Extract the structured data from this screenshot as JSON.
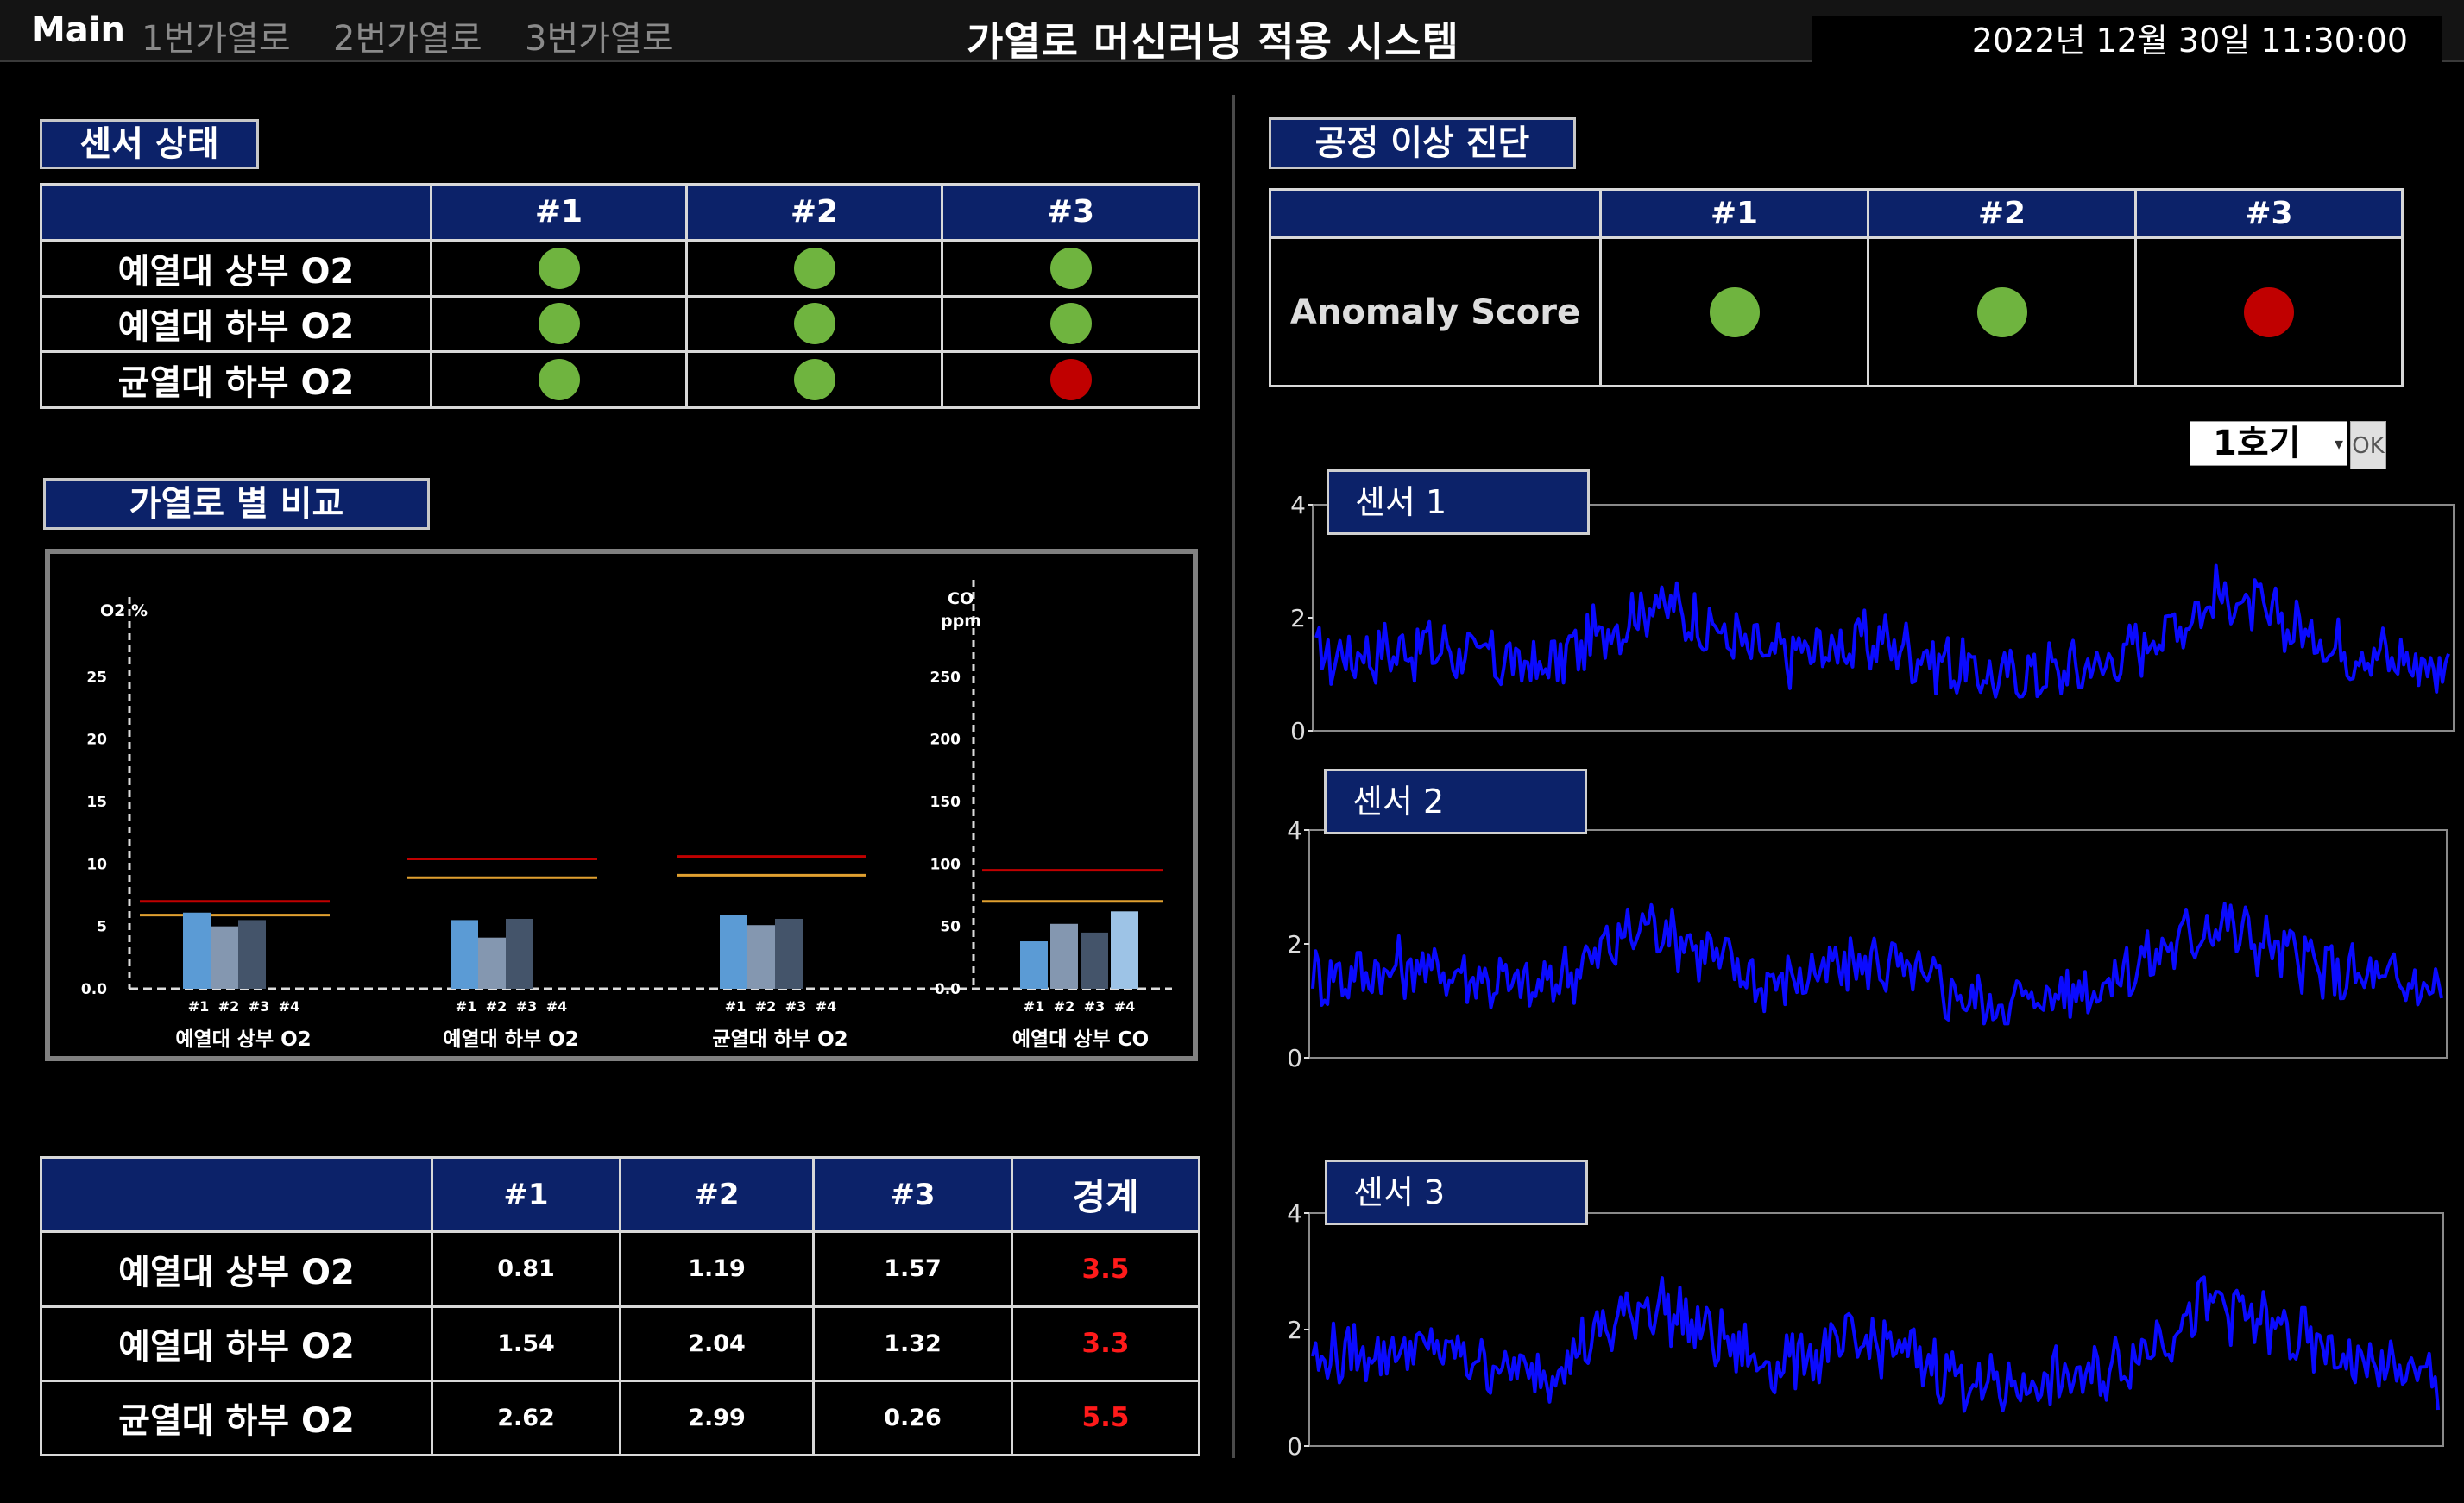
{
  "nav": {
    "main": "Main",
    "items": [
      "1번가열로",
      "2번가열로",
      "3번가열로"
    ],
    "title": "가열로 머신러닝 적용 시스템",
    "datetime": "2022년 12월 30일 11:30:00"
  },
  "sensor_status": {
    "badge": "센서 상태",
    "columns": [
      "#1",
      "#2",
      "#3"
    ],
    "rows": [
      {
        "label": "예열대 상부 O2",
        "status": [
          "green",
          "green",
          "green"
        ]
      },
      {
        "label": "예열대 하부 O2",
        "status": [
          "green",
          "green",
          "green"
        ]
      },
      {
        "label": "균열대 하부 O2",
        "status": [
          "green",
          "green",
          "red"
        ]
      }
    ]
  },
  "process_diag": {
    "badge": "공정 이상 진단",
    "columns": [
      "#1",
      "#2",
      "#3"
    ],
    "row_label": "Anomaly Score",
    "status": [
      "green",
      "green",
      "red"
    ]
  },
  "compare": {
    "badge": "가열로 별 비교",
    "left_axis_label": "O2 %",
    "right_axis_label_1": "CO",
    "right_axis_label_2": "ppm"
  },
  "chart_data": [
    {
      "type": "bar",
      "title": "",
      "ylabel": "O2 %",
      "ylim": [
        0,
        30
      ],
      "yticks": [
        "0.0",
        "5",
        "10",
        "15",
        "20",
        "25"
      ],
      "groups": [
        {
          "label": "예열대 상부 O2",
          "categories": [
            "#1",
            "#2",
            "#3",
            "#4"
          ],
          "values": [
            6.1,
            5.0,
            5.5,
            null
          ],
          "limit_red": 7.0,
          "limit_orange": 5.9
        },
        {
          "label": "예열대 하부 O2",
          "categories": [
            "#1",
            "#2",
            "#3",
            "#4"
          ],
          "values": [
            5.5,
            4.1,
            5.6,
            null
          ],
          "limit_red": 10.4,
          "limit_orange": 8.9
        },
        {
          "label": "균열대 하부 O2",
          "categories": [
            "#1",
            "#2",
            "#3",
            "#4"
          ],
          "values": [
            5.9,
            5.1,
            5.6,
            null
          ],
          "limit_red": 10.6,
          "limit_orange": 9.1
        }
      ],
      "bar_colors": [
        "#5b9bd5",
        "#8497b0",
        "#44546a"
      ],
      "red_line_color": "#c00000",
      "orange_line_color": "#e0a030"
    },
    {
      "type": "bar",
      "title": "",
      "ylabel": "CO ppm",
      "ylim": [
        0,
        300
      ],
      "yticks": [
        "0.0",
        "50",
        "100",
        "150",
        "200",
        "250"
      ],
      "groups": [
        {
          "label": "예열대 상부 CO",
          "categories": [
            "#1",
            "#2",
            "#3",
            "#4"
          ],
          "values": [
            38,
            52,
            45,
            62
          ],
          "limit_red": 95,
          "limit_orange": 70
        }
      ],
      "bar_colors": [
        "#5b9bd5",
        "#8497b0",
        "#44546a",
        "#9dc3e6"
      ],
      "red_line_color": "#c00000",
      "orange_line_color": "#e0a030"
    },
    {
      "type": "line",
      "title": "센서 1",
      "ylim": [
        0,
        4
      ],
      "yticks": [
        "0",
        "2",
        "4"
      ],
      "color": "#0a0aff",
      "key_points": {
        "x": [
          0,
          0.1,
          0.2,
          0.3,
          0.4,
          0.5,
          0.6,
          0.7,
          0.8,
          0.9,
          1.0
        ],
        "y": [
          1.3,
          1.5,
          1.1,
          2.3,
          1.3,
          1.6,
          0.9,
          1.2,
          2.4,
          1.5,
          1.1
        ]
      }
    },
    {
      "type": "line",
      "title": "센서 2",
      "ylim": [
        0,
        4
      ],
      "yticks": [
        "0",
        "2",
        "4"
      ],
      "color": "#0a0aff",
      "key_points": {
        "x": [
          0,
          0.1,
          0.2,
          0.3,
          0.4,
          0.5,
          0.6,
          0.7,
          0.8,
          0.9,
          1.0
        ],
        "y": [
          1.4,
          1.6,
          1.2,
          2.4,
          1.3,
          1.7,
          0.9,
          1.3,
          2.4,
          1.5,
          1.2
        ]
      }
    },
    {
      "type": "line",
      "title": "센서 3",
      "ylim": [
        0,
        4
      ],
      "yticks": [
        "0",
        "2",
        "4"
      ],
      "color": "#0a0aff",
      "key_points": {
        "x": [
          0,
          0.1,
          0.2,
          0.3,
          0.4,
          0.5,
          0.6,
          0.7,
          0.8,
          0.9,
          1.0
        ],
        "y": [
          1.5,
          1.7,
          1.2,
          2.5,
          1.4,
          1.8,
          1.0,
          1.2,
          2.5,
          1.6,
          1.1
        ]
      }
    }
  ],
  "values_table": {
    "columns": [
      "#1",
      "#2",
      "#3",
      "경계"
    ],
    "rows": [
      {
        "label": "예열대 상부 O2",
        "values": [
          "0.81",
          "1.19",
          "1.57"
        ],
        "limit": "3.5"
      },
      {
        "label": "예열대 하부 O2",
        "values": [
          "1.54",
          "2.04",
          "1.32"
        ],
        "limit": "3.3"
      },
      {
        "label": "균열대 하부 O2",
        "values": [
          "2.62",
          "2.99",
          "0.26"
        ],
        "limit": "5.5"
      }
    ]
  },
  "unit_selector": {
    "selected": "1호기",
    "ok": "OK"
  },
  "colors": {
    "header_blue": "#0c2269",
    "ok_green": "#6fb43f",
    "alarm_red": "#c00000",
    "trend_blue": "#0a0aff"
  }
}
